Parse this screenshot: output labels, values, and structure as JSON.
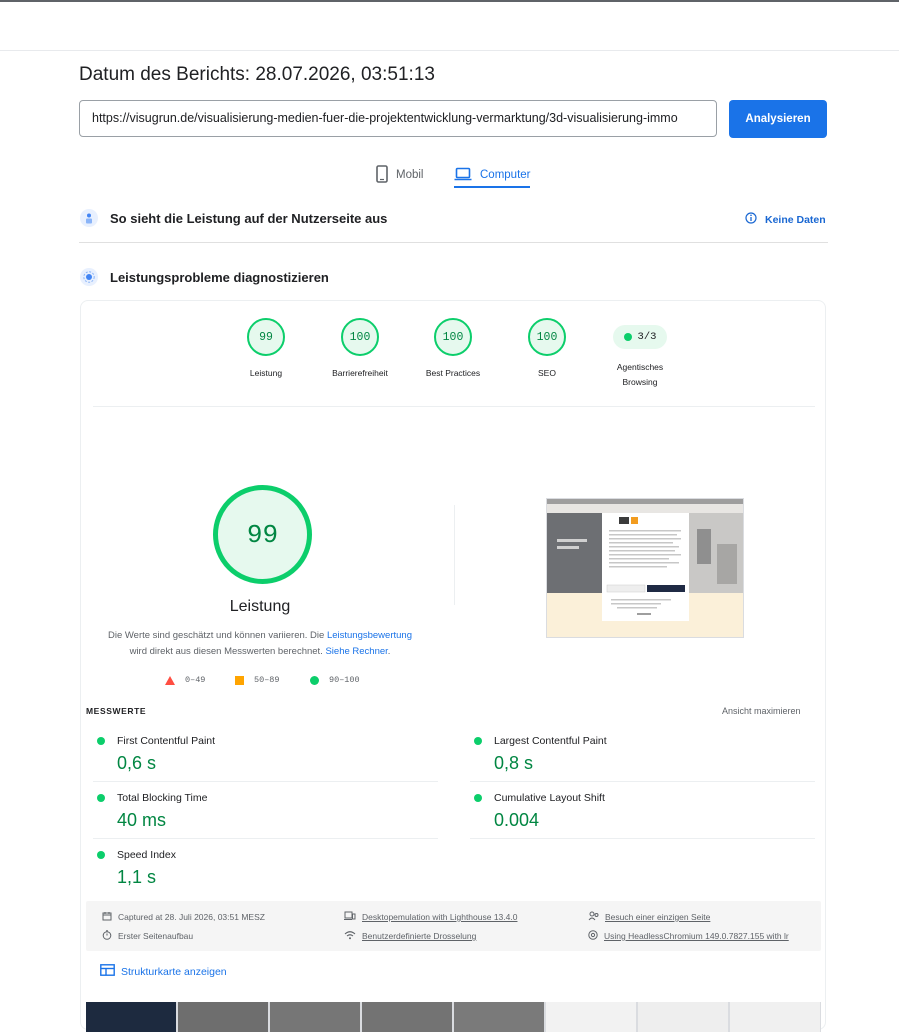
{
  "report": {
    "title": "Datum des Berichts: 28.07.2026, 03:51:13"
  },
  "search": {
    "url": "https://visugrun.de/visualisierung-medien-fuer-die-projektentwicklung-vermarktung/3d-visualisierung-immo",
    "analyze_label": "Analysieren"
  },
  "tabs": [
    {
      "label": "Mobil",
      "icon": "smartphone-icon",
      "active": false
    },
    {
      "label": "Computer",
      "icon": "laptop-icon",
      "active": true
    }
  ],
  "field_data": {
    "title": "So sieht die Leistung auf der Nutzerseite aus",
    "status": "Keine Daten"
  },
  "lab": {
    "title": "Leistungsprobleme diagnostizieren",
    "gauges": [
      {
        "score": "99",
        "label": "Leistung"
      },
      {
        "score": "100",
        "label": "Barrierefreiheit"
      },
      {
        "score": "100",
        "label": "Best Practices"
      },
      {
        "score": "100",
        "label": "SEO"
      }
    ],
    "agentic": {
      "value": "3/3",
      "label_line1": "Agentisches",
      "label_line2": "Browsing"
    }
  },
  "performance": {
    "score": "99",
    "title": "Leistung",
    "note_part1": "Die Werte sind geschätzt und können variieren. Die ",
    "note_link1": "Leistungsbewertung",
    "note_part2": " wird direkt aus diesen Messwerten berechnet. ",
    "note_link2": "Siehe Rechner",
    "note_end": ".",
    "legend": {
      "fail": "0–49",
      "average": "50–89",
      "pass": "90–100"
    }
  },
  "metrics": {
    "header": "MESSWERTE",
    "maximize": "Ansicht maximieren",
    "items": [
      {
        "label": "First Contentful Paint",
        "value": "0,6 s"
      },
      {
        "label": "Largest Contentful Paint",
        "value": "0,8 s"
      },
      {
        "label": "Total Blocking Time",
        "value": "40 ms"
      },
      {
        "label": "Cumulative Layout Shift",
        "value": "0.004"
      },
      {
        "label": "Speed Index",
        "value": "1,1 s"
      }
    ]
  },
  "run_info": {
    "captured": "Captured at 28. Juli 2026, 03:51 MESZ",
    "first_load": "Erster Seitenaufbau",
    "emulation": "Desktopemulation with Lighthouse 13.4.0",
    "throttling": "Benutzerdefinierte Drosselung",
    "session": "Besuch einer einzigen Seite",
    "browser": "Using HeadlessChromium 149.0.7827.155 with lr"
  },
  "treemap": {
    "label": "Strukturkarte anzeigen"
  },
  "colors": {
    "pass": "#0cce6b",
    "average": "#ffa400",
    "fail": "#ff4e42",
    "accent": "#1a73e8"
  }
}
